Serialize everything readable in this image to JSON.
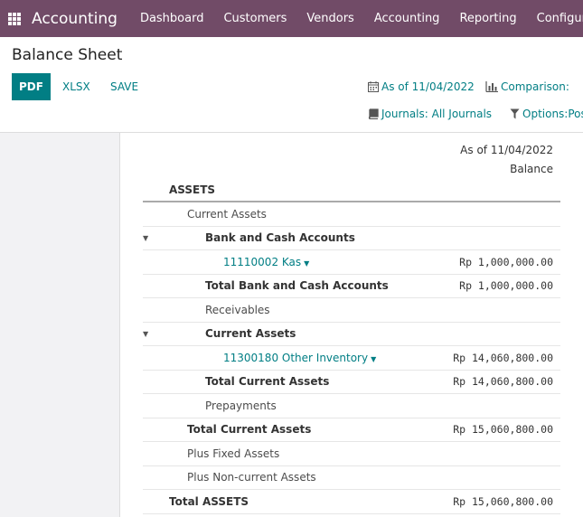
{
  "topbar": {
    "app_name": "Accounting",
    "menu": [
      "Dashboard",
      "Customers",
      "Vendors",
      "Accounting",
      "Reporting",
      "Configuration"
    ]
  },
  "page": {
    "title": "Balance Sheet"
  },
  "toolbar": {
    "pdf": "PDF",
    "xlsx": "XLSX",
    "save": "SAVE"
  },
  "filters": {
    "date": "As of 11/04/2022",
    "comparison": "Comparison:",
    "journals": "Journals: All Journals",
    "options": "Options:Pos"
  },
  "report": {
    "column_date": "As of 11/04/2022",
    "column_name": "Balance",
    "rows": [
      {
        "label": "ASSETS",
        "value": ""
      },
      {
        "label": "Current Assets",
        "value": ""
      },
      {
        "label": "Bank and Cash Accounts",
        "value": ""
      },
      {
        "label": "11110002 Kas",
        "value": "Rp 1,000,000.00"
      },
      {
        "label": "Total Bank and Cash Accounts",
        "value": "Rp 1,000,000.00"
      },
      {
        "label": "Receivables",
        "value": ""
      },
      {
        "label": "Current Assets",
        "value": ""
      },
      {
        "label": "11300180 Other Inventory",
        "value": "Rp 14,060,800.00"
      },
      {
        "label": "Total Current Assets",
        "value": "Rp 14,060,800.00"
      },
      {
        "label": "Prepayments",
        "value": ""
      },
      {
        "label": "Total Current Assets",
        "value": "Rp 15,060,800.00"
      },
      {
        "label": "Plus Fixed Assets",
        "value": ""
      },
      {
        "label": "Plus Non-current Assets",
        "value": ""
      },
      {
        "label": "Total ASSETS",
        "value": "Rp 15,060,800.00"
      }
    ]
  }
}
